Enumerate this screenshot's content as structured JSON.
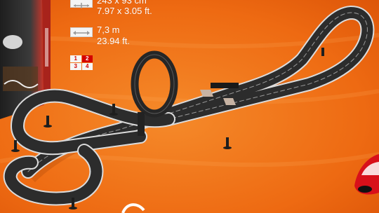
{
  "specs": {
    "size_metric": "243 x 93 cm",
    "size_imperial": "7.97 x 3.05 ft.",
    "length_metric": "7,3 m",
    "length_imperial": "23.94 ft."
  },
  "players": {
    "cells": [
      "1",
      "2",
      "3",
      "4"
    ],
    "active": "2"
  },
  "colors": {
    "background": "#f26a10",
    "track": "#2c2c2c",
    "track_edge": "#dcdcdc",
    "red_car": "#d8101a"
  },
  "icons": {
    "dimensions": "arrows-expand-icon",
    "length": "double-arrow-icon"
  }
}
